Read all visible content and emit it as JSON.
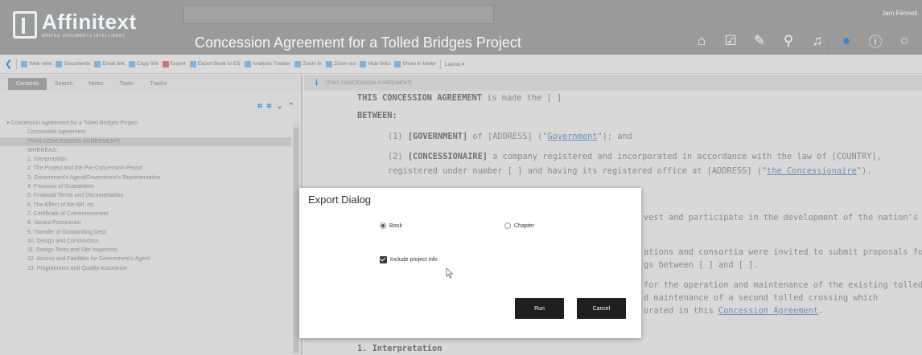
{
  "app": {
    "logo_title": "Affinitext",
    "logo_subtitle": "MAKING DOCUMENTS INTELLIGENT",
    "document_title": "Concession Agreement for a Tolled Bridges Project",
    "user_name": "Jarn Fennell",
    "notification_count": "1"
  },
  "header_icons": [
    "home-icon",
    "checklist-icon",
    "edit-doc-icon",
    "wrench-icon",
    "bell-icon",
    "chat-icon",
    "info-icon",
    "search-icon"
  ],
  "toolbar": {
    "items": [
      {
        "label": "Web view",
        "icon": "web-view-icon"
      },
      {
        "label": "Documents",
        "icon": "documents-icon"
      },
      {
        "label": "Email link",
        "icon": "email-icon"
      },
      {
        "label": "Copy link",
        "icon": "copy-link-icon"
      },
      {
        "label": "Export",
        "icon": "export-icon"
      },
      {
        "label": "Export Book to ES",
        "icon": "export-book-icon"
      },
      {
        "label": "Analysis Tracker",
        "icon": "analysis-icon"
      },
      {
        "label": "Zoom in",
        "icon": "zoom-in-icon"
      },
      {
        "label": "Zoom out",
        "icon": "zoom-out-icon"
      },
      {
        "label": "Hide links",
        "icon": "hide-links-icon"
      },
      {
        "label": "Show in folder",
        "icon": "folder-icon"
      },
      {
        "label": "Layout ▾",
        "icon": ""
      }
    ]
  },
  "left_panel": {
    "tabs": [
      "Contents",
      "Search",
      "Notes",
      "Tasks",
      "Tracks"
    ],
    "active_tab": "Contents",
    "tree": [
      "Concession Agreement for a Tolled Bridges Project",
      "Concession Agreement",
      "[THIS CONCESSION AGREEMENT]",
      "WHEREAS:",
      "1. Interpretation",
      "2. The Project and the Pre-Concession Period",
      "3. Government's Agent/Government's Representative",
      "4. Provision of Guarantees",
      "5. Financial Terms and Documentation",
      "6. The Effect of the Bill, etc",
      "7. Certificate of Commencement",
      "8. Vacant Possession",
      "9. Transfer of Outstanding Debt",
      "10. Design and Construction",
      "11. Design Tests and Site Inspection",
      "12. Access and Facilities for Government's Agent",
      "13. Programmes and Quality Assurance"
    ],
    "selected_index": 2
  },
  "document": {
    "crumb": "[THIS CONCESSION AGREEMENT]",
    "p1_bold": "THIS CONCESSION AGREEMENT",
    "p1_rest": " is made the [   ]",
    "p2": "BETWEEN:",
    "p3_pre": "(1) ",
    "p3_bold": "[GOVERNMENT]",
    "p3_mid": " of [ADDRESS] (\"",
    "p3_link": "Government",
    "p3_end": "\"); and",
    "p4_pre": "(2) ",
    "p4_bold": "[CONCESSIONAIRE]",
    "p4_rest": " a company registered and incorporated in accordance with the law of [COUNTRY],",
    "p5_pre": "registered under number [    ] and having its registered office at [ADDRESS] (\"",
    "p5_link": "the Concessionaire",
    "p5_end": "\").",
    "p6": "vest and participate in the development of the nation's",
    "p7": "ations and consortia were invited to submit proposals for",
    "p8": "gs between [   ] and [   ].",
    "p9": "for the operation and maintenance of the existing tolled",
    "p10": "d maintenance of a second tolled crossing which",
    "p11_pre": "orated in this ",
    "p11_link": "Concession Agreement",
    "p11_end": ".",
    "section": "1. Interpretation"
  },
  "export_dialog": {
    "title": "Export Dialog",
    "option_book": "Book",
    "option_chapter": "Chapter",
    "selected_option": "Book",
    "include_project_info_label": "Include project info",
    "include_project_info_checked": true,
    "run_label": "Run",
    "cancel_label": "Cancel"
  }
}
